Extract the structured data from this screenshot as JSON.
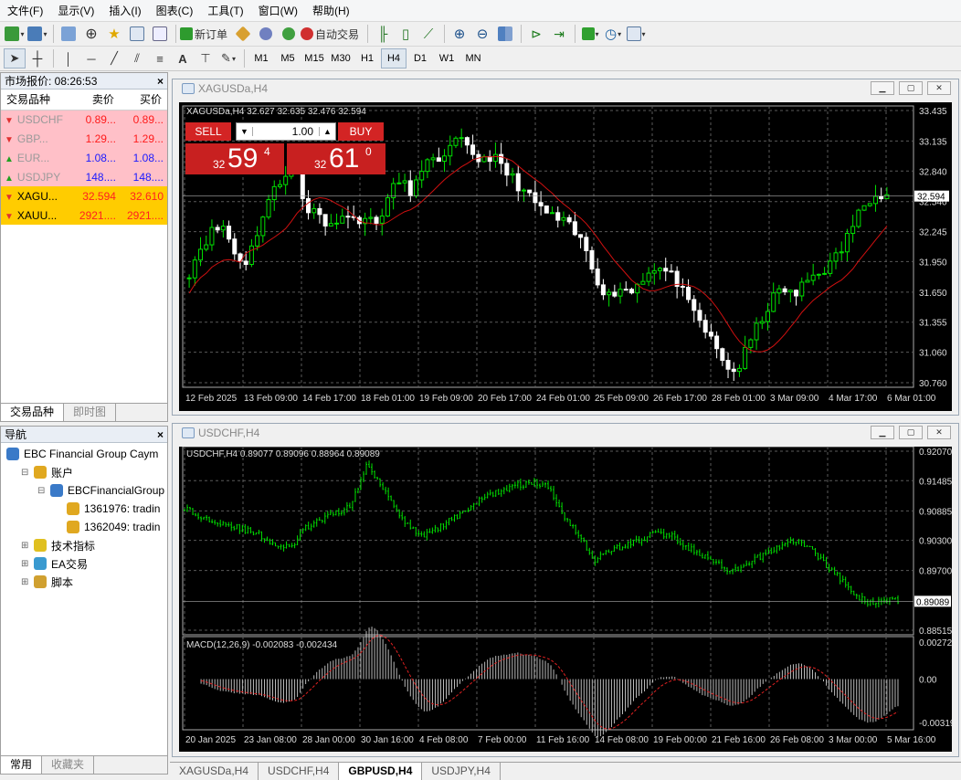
{
  "menu": [
    "文件(F)",
    "显示(V)",
    "插入(I)",
    "图表(C)",
    "工具(T)",
    "窗口(W)",
    "帮助(H)"
  ],
  "toolbar": {
    "new_order": "新订单",
    "auto_trading": "自动交易"
  },
  "timeframes": [
    "M1",
    "M5",
    "M15",
    "M30",
    "H1",
    "H4",
    "D1",
    "W1",
    "MN"
  ],
  "active_timeframe": "H4",
  "market_watch": {
    "title": "市场报价: 08:26:53",
    "headers": [
      "交易品种",
      "卖价",
      "买价"
    ],
    "rows": [
      {
        "symbol": "USDCHF",
        "bid": "0.89...",
        "ask": "0.89...",
        "style": "pink",
        "arrow": "down"
      },
      {
        "symbol": "GBP...",
        "bid": "1.29...",
        "ask": "1.29...",
        "style": "pink",
        "arrow": "down"
      },
      {
        "symbol": "EUR...",
        "bid": "1.08...",
        "ask": "1.08...",
        "style": "pink-blue",
        "arrow": "up"
      },
      {
        "symbol": "USDJPY",
        "bid": "148....",
        "ask": "148....",
        "style": "pink-blue",
        "arrow": "up"
      },
      {
        "symbol": "XAGU...",
        "bid": "32.594",
        "ask": "32.610",
        "style": "yellow",
        "arrow": "down"
      },
      {
        "symbol": "XAUU...",
        "bid": "2921....",
        "ask": "2921....",
        "style": "yellow",
        "arrow": "down"
      }
    ],
    "tabs": [
      "交易品种",
      "即时图"
    ]
  },
  "navigator": {
    "title": "导航",
    "items": [
      "EBC Financial Group Caym",
      "账户",
      "EBCFinancialGroup",
      "1361976: tradin",
      "1362049: tradin",
      "技术指标",
      "EA交易",
      "脚本"
    ],
    "tabs": [
      "常用",
      "收藏夹"
    ]
  },
  "chart1": {
    "window_title": "XAGUSDa,H4",
    "header": "XAGUSDa,H4  32.627 32.635 32.476 32.594",
    "sell_label": "SELL",
    "buy_label": "BUY",
    "lot": "1.00",
    "sell_price": {
      "prefix": "32",
      "big": "59",
      "sup": "4"
    },
    "buy_price": {
      "prefix": "32",
      "big": "61",
      "sup": "0"
    },
    "current_price": "32.594",
    "y_ticks": [
      "33.435",
      "33.135",
      "32.840",
      "32.540",
      "32.245",
      "31.950",
      "31.650",
      "31.355",
      "31.060",
      "30.760"
    ],
    "x_ticks": [
      "12 Feb 2025",
      "13 Feb 09:00",
      "14 Feb 17:00",
      "18 Feb 01:00",
      "19 Feb 09:00",
      "20 Feb 17:00",
      "24 Feb 01:00",
      "25 Feb 09:00",
      "26 Feb 17:00",
      "28 Feb 01:00",
      "3 Mar 09:00",
      "4 Mar 17:00",
      "6 Mar 01:00"
    ],
    "close_path": [
      31.85,
      32.1,
      32.25,
      32.3,
      32.0,
      31.95,
      32.3,
      32.6,
      32.75,
      33.05,
      32.4,
      32.5,
      32.25,
      32.45,
      32.35,
      32.4,
      32.3,
      32.55,
      32.75,
      32.65,
      32.8,
      33.0,
      32.95,
      33.15,
      33.05,
      32.95,
      33.0,
      32.85,
      32.75,
      32.6,
      32.5,
      32.4,
      32.35,
      32.25,
      32.1,
      31.8,
      31.6,
      31.7,
      31.65,
      31.8,
      31.9,
      31.85,
      31.75,
      31.5,
      31.35,
      31.15,
      30.95,
      30.85,
      31.1,
      31.35,
      31.55,
      31.7,
      31.6,
      31.75,
      31.85,
      31.9,
      32.05,
      32.3,
      32.5,
      32.65,
      32.6
    ]
  },
  "chart2": {
    "window_title": "USDCHF,H4",
    "header": "USDCHF,H4  0.89077 0.89096 0.88964 0.89089",
    "current_price": "0.89089",
    "y_ticks": [
      "0.92070",
      "0.91485",
      "0.90885",
      "0.90300",
      "0.89700",
      "0.89089",
      "0.88515"
    ],
    "macd_header": "MACD(12,26,9) -0.002083 -0.002434",
    "macd_ticks": [
      "0.002727",
      "0.00",
      "-0.003196"
    ],
    "x_ticks": [
      "20 Jan 2025",
      "23 Jan 08:00",
      "28 Jan 00:00",
      "30 Jan 16:00",
      "4 Feb 08:00",
      "7 Feb 00:00",
      "11 Feb 16:00",
      "14 Feb 08:00",
      "19 Feb 00:00",
      "21 Feb 16:00",
      "26 Feb 08:00",
      "3 Mar 00:00",
      "5 Mar 16:00"
    ],
    "close_path": [
      0.9095,
      0.9075,
      0.907,
      0.906,
      0.905,
      0.904,
      0.902,
      0.9015,
      0.9055,
      0.907,
      0.9085,
      0.91,
      0.918,
      0.914,
      0.909,
      0.905,
      0.904,
      0.906,
      0.908,
      0.91,
      0.912,
      0.913,
      0.914,
      0.9145,
      0.9135,
      0.908,
      0.904,
      0.899,
      0.901,
      0.902,
      0.903,
      0.9045,
      0.904,
      0.902,
      0.9,
      0.8985,
      0.8965,
      0.898,
      0.9,
      0.9015,
      0.903,
      0.902,
      0.899,
      0.896,
      0.8925,
      0.8905,
      0.8915,
      0.8909
    ]
  },
  "bottom_tabs": [
    "XAGUSDa,H4",
    "USDCHF,H4",
    "GBPUSD,H4",
    "USDJPY,H4"
  ],
  "active_bottom_tab": "GBPUSD,H4",
  "colors": {
    "bull": "#00e000",
    "bear": "#ffffff",
    "ma": "#d01010",
    "sell": "#d32424",
    "grid": "#5a5a5a"
  }
}
